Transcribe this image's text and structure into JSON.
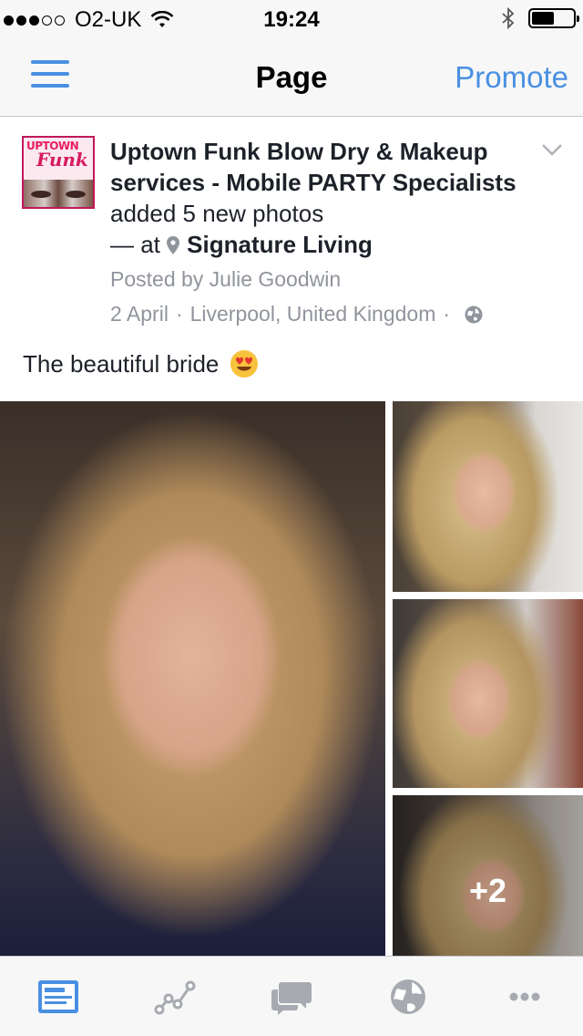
{
  "status_bar": {
    "signal_filled": 3,
    "signal_total": 5,
    "carrier": "O2-UK",
    "time": "19:24",
    "battery_level": 0.55
  },
  "nav": {
    "title": "Page",
    "promote_label": "Promote",
    "accent_color": "#4a90e2"
  },
  "post": {
    "page_name": "Uptown Funk Blow Dry & Makeup services  - Mobile PARTY Specialists",
    "action_text": "added 5 new photos",
    "at_text": "— at",
    "location": "Signature Living",
    "posted_by": "Posted by Julie Goodwin",
    "date": "2 April",
    "place": "Liverpool, United Kingdom",
    "separator": "·",
    "caption": "The beautiful bride",
    "caption_emoji": "heart-eyes-emoji",
    "extra_photos": "+2"
  },
  "avatar": {
    "logo_line1": "UPTOWN",
    "logo_line2": "Funk"
  },
  "tabs": [
    {
      "icon": "news-feed-icon",
      "active": true
    },
    {
      "icon": "insights-icon",
      "active": false
    },
    {
      "icon": "messages-icon",
      "active": false
    },
    {
      "icon": "globe-icon",
      "active": false
    },
    {
      "icon": "more-icon",
      "active": false
    }
  ]
}
